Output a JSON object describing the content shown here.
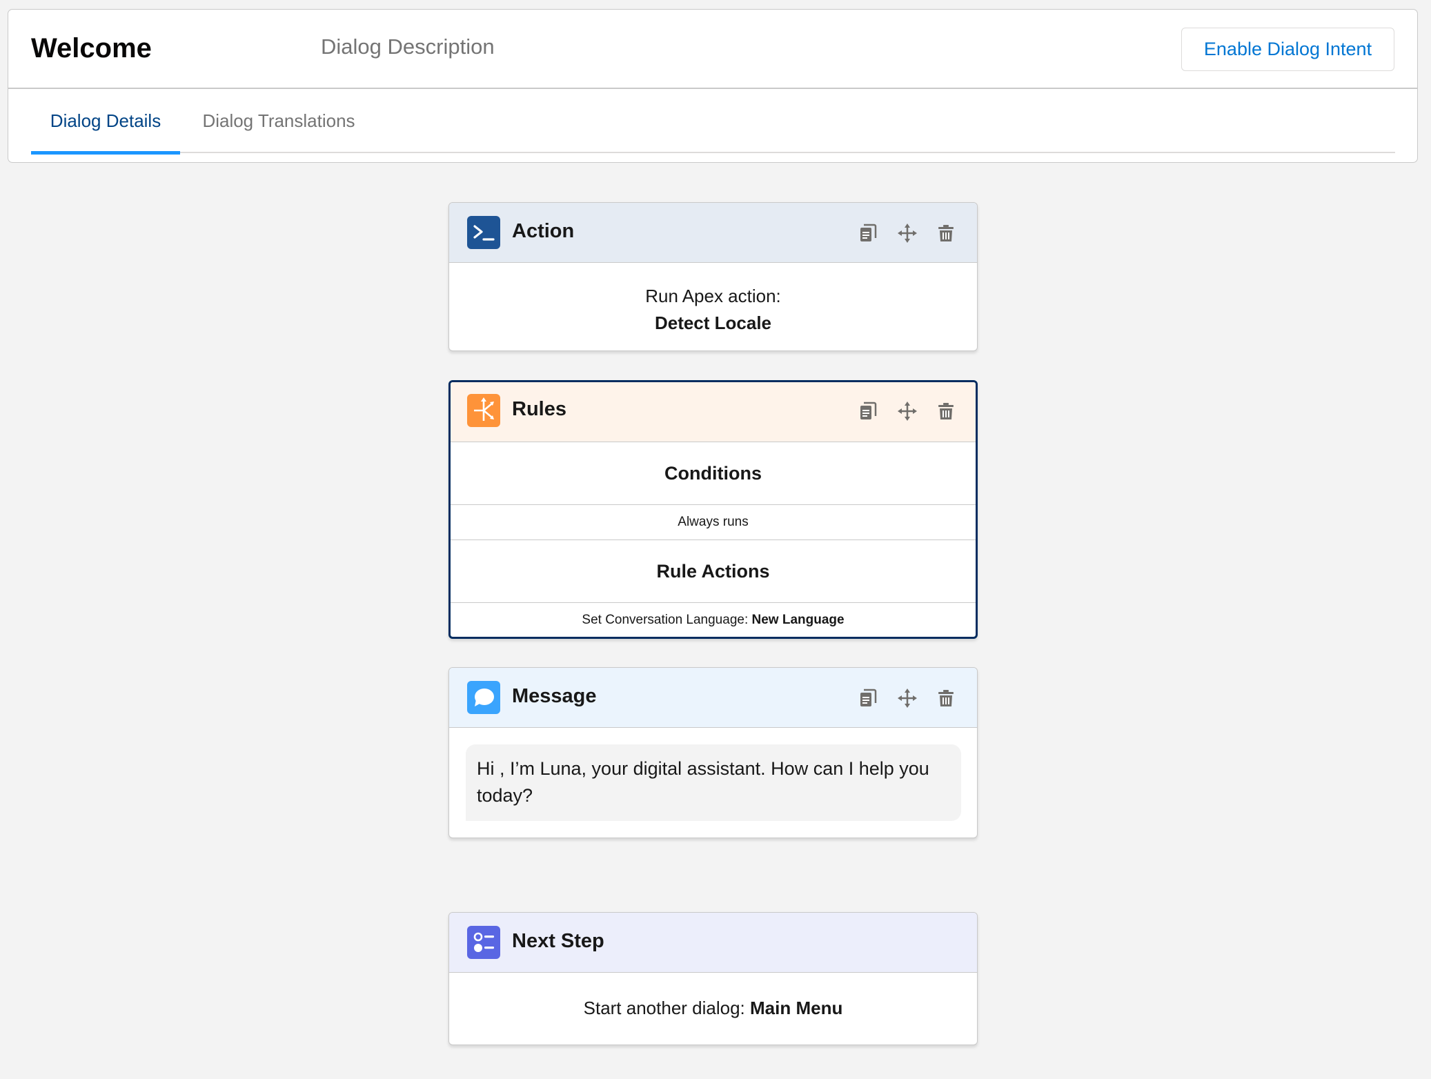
{
  "header": {
    "title": "Welcome",
    "description": "Dialog Description",
    "enable_button": "Enable Dialog Intent"
  },
  "tabs": [
    {
      "label": "Dialog Details",
      "active": true
    },
    {
      "label": "Dialog Translations",
      "active": false
    }
  ],
  "icons": {
    "action": "terminal-icon",
    "rules": "decision-icon",
    "message": "chat-bubble-icon",
    "next_step": "next-step-icon",
    "copy": "copy-icon",
    "move": "move-icon",
    "delete": "trash-icon"
  },
  "colors": {
    "action_icon_bg": "#1e5495",
    "rules_icon_bg": "#fe9339",
    "message_icon_bg": "#3aa4fd",
    "next_step_icon_bg": "#5966e3",
    "selected_border": "#032d60",
    "tab_active_underline": "#1b96ff",
    "link_blue": "#0176d3"
  },
  "steps": {
    "action": {
      "title": "Action",
      "line1": "Run Apex action:",
      "line2": "Detect Locale"
    },
    "rules": {
      "title": "Rules",
      "conditions_label": "Conditions",
      "conditions_value": "Always runs",
      "rule_actions_label": "Rule Actions",
      "rule_action_prefix": "Set Conversation Language:",
      "rule_action_value": "New Language",
      "selected": true
    },
    "message": {
      "title": "Message",
      "text": "Hi , I’m Luna, your digital assistant. How can I help you today?"
    },
    "next_step": {
      "title": "Next Step",
      "prefix": "Start another dialog:",
      "value": "Main Menu"
    }
  }
}
